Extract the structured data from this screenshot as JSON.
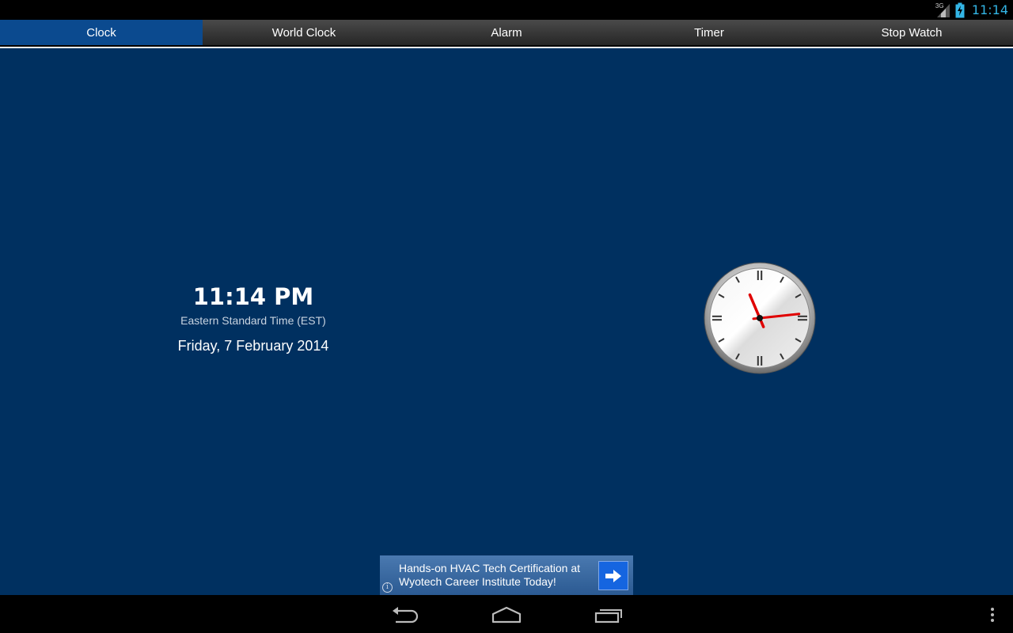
{
  "status_bar": {
    "network_label": "3G",
    "time": "11:14",
    "icons": [
      "signal-icon",
      "battery-charging-icon"
    ]
  },
  "tabs": [
    {
      "label": "Clock",
      "active": true
    },
    {
      "label": "World Clock",
      "active": false
    },
    {
      "label": "Alarm",
      "active": false
    },
    {
      "label": "Timer",
      "active": false
    },
    {
      "label": "Stop Watch",
      "active": false
    }
  ],
  "clock": {
    "time": "11:14 PM",
    "timezone": "Eastern Standard Time (EST)",
    "date": "Friday, 7 February 2014",
    "analog": {
      "hour": 11,
      "minute": 14
    }
  },
  "ad": {
    "line1": "Hands-on HVAC Tech Certification at",
    "line2": "Wyotech Career Institute Today!",
    "info_glyph": "i"
  },
  "nav_bar": {
    "icons": [
      "back-icon",
      "home-icon",
      "recent-apps-icon",
      "overflow-menu-icon"
    ]
  },
  "colors": {
    "background": "#003060",
    "active_tab": "#0b4a8f",
    "status_time": "#33b5e5",
    "hand": "#e00000"
  }
}
